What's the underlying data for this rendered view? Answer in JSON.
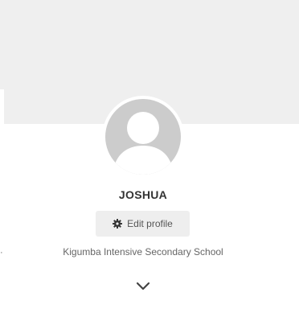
{
  "profile": {
    "name": "JOSHUA",
    "edit_label": "Edit profile",
    "school": "Kigumba Intensive Secondary School"
  },
  "icons": {
    "avatar": "default-user-silhouette",
    "edit": "gear-icon",
    "expand": "chevron-down-icon"
  },
  "colors": {
    "cover": "#efefef",
    "avatar_bg": "#cccccc",
    "button_bg": "#eeeeee"
  }
}
